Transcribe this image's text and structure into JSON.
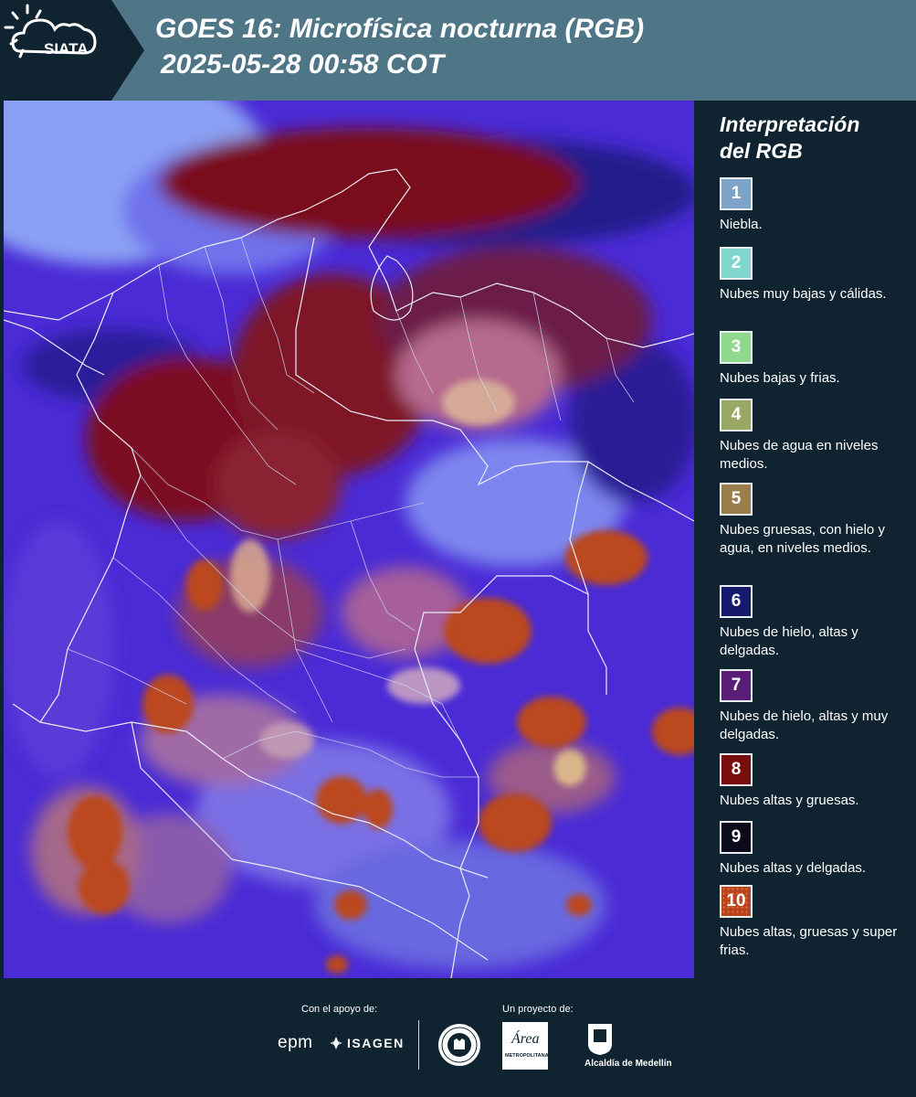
{
  "header": {
    "logo_text": "SIATA",
    "title": "GOES 16: Microfísica nocturna (RGB)",
    "subtitle": "2025-05-28 00:58 COT"
  },
  "legend": {
    "title_line1": "Interpretación",
    "title_line2": "del RGB",
    "items": [
      {
        "number": "1",
        "label": "Niebla.",
        "color": "#7fa3c6"
      },
      {
        "number": "2",
        "label": "Nubes muy bajas y cálidas.",
        "color": "#7fd6cd"
      },
      {
        "number": "3",
        "label": "Nubes bajas y frias.",
        "color": "#8fd98f"
      },
      {
        "number": "4",
        "label": "Nubes de agua en niveles medios.",
        "color": "#9aa865"
      },
      {
        "number": "5",
        "label": "Nubes gruesas, con hielo y agua, en niveles medios.",
        "color": "#9a7e4c"
      },
      {
        "number": "6",
        "label": "Nubes de hielo, altas y delgadas.",
        "color": "#151a6c"
      },
      {
        "number": "7",
        "label": "Nubes de hielo, altas y muy delgadas.",
        "color": "#5a1e78"
      },
      {
        "number": "8",
        "label": "Nubes altas y gruesas.",
        "color": "#7a0e0e"
      },
      {
        "number": "9",
        "label": "Nubes altas y delgadas.",
        "color": "#0a0a18"
      },
      {
        "number": "10",
        "label": "Nubes altas, gruesas y super frias.",
        "color": "#b8411f"
      }
    ]
  },
  "footer": {
    "support_label": "Con el apoyo de:",
    "project_label": "Un proyecto de:",
    "epm": "epm",
    "isagen": "ISAGEN",
    "area_text": "Área",
    "area_sub": "METROPOLITANA",
    "alcaldia": "Alcaldía de Medellín"
  },
  "colors": {
    "header_bg": "#4e7686",
    "panel_bg": "#0f2331",
    "map_base": "#4a2bd6"
  }
}
